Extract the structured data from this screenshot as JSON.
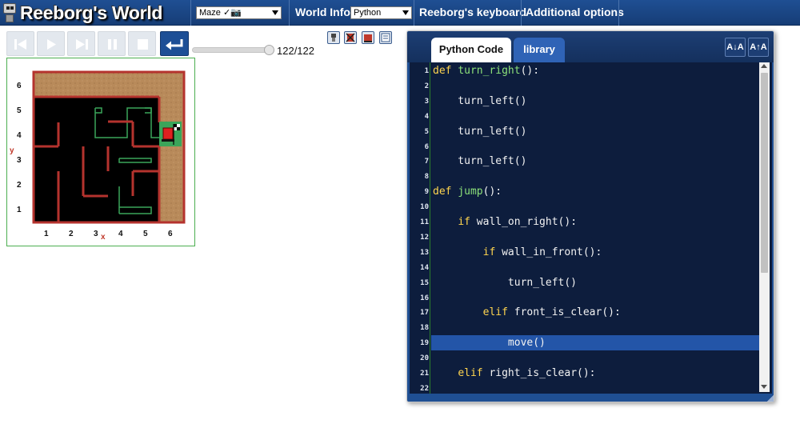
{
  "app": {
    "title": "Reeborg's World"
  },
  "navbar": {
    "world_select": "Maze ✓📷",
    "world_info": "World Info",
    "language_select": "Python",
    "keyboard": "Reeborg's keyboard",
    "additional_options": "Additional options"
  },
  "controls": {
    "buttons": [
      "reverse-step",
      "run",
      "step",
      "pause",
      "stop",
      "reload"
    ],
    "step_counter": "122/122",
    "slider_fraction": 1.0
  },
  "world": {
    "x_ticks": [
      "1",
      "2",
      "3",
      "4",
      "5",
      "6"
    ],
    "y_ticks": [
      "1",
      "2",
      "3",
      "4",
      "5",
      "6"
    ],
    "x_name": "x",
    "y_name": "y",
    "colors": {
      "wall": "#b5332e",
      "sand": "#b88a5a",
      "path_trace": "#3aa55a",
      "goal": "#3aa55a"
    }
  },
  "editor": {
    "tabs": [
      "Python Code",
      "library"
    ],
    "active_tab": "Python Code",
    "font_buttons": [
      "A↓A",
      "A↑A"
    ],
    "active_line": 19,
    "lines": [
      "def turn_right():",
      "",
      "    turn_left()",
      "",
      "    turn_left()",
      "",
      "    turn_left()",
      "",
      "def jump():",
      "",
      "    if wall_on_right():",
      "",
      "        if wall_in_front():",
      "",
      "            turn_left()",
      "",
      "        elif front_is_clear():",
      "",
      "            move()",
      "",
      "    elif right_is_clear():",
      ""
    ]
  }
}
